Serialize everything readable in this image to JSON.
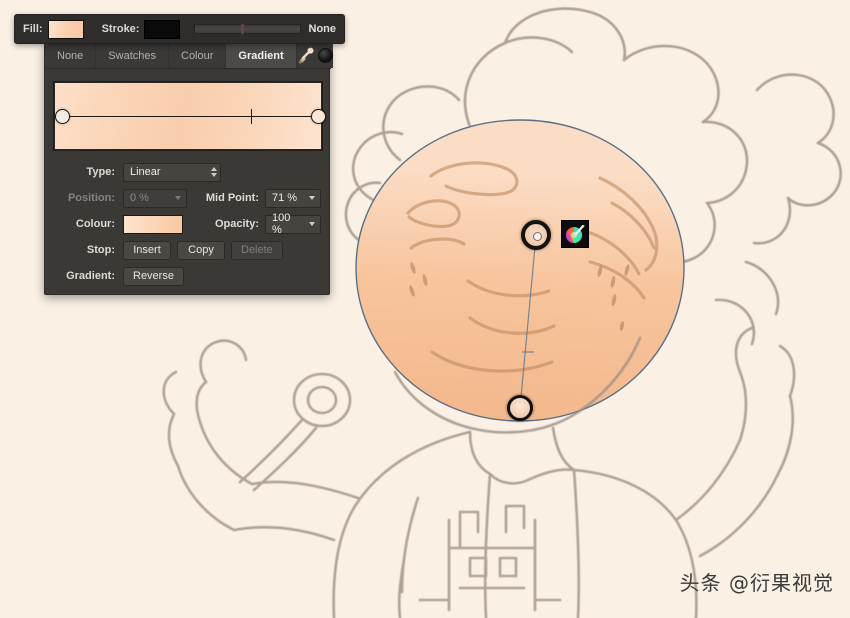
{
  "app": {
    "background_color": "#faf0e4"
  },
  "fill_stroke_bar": {
    "fill_label": "Fill:",
    "stroke_label": "Stroke:",
    "none_label": "None",
    "fill_color": "#fbcfae",
    "stroke_color": "#0b0a0a"
  },
  "panel": {
    "tabs": [
      {
        "label": "None",
        "active": false
      },
      {
        "label": "Swatches",
        "active": false
      },
      {
        "label": "Colour",
        "active": false
      },
      {
        "label": "Gradient",
        "active": true
      }
    ],
    "tools": {
      "pipette": "eyedropper-icon",
      "swatch": "dark-circle-swatch"
    },
    "gradient_preview": {
      "start_color": "#fcdfc8",
      "mid_color": "#f9cdac",
      "end_color": "#fde3cf",
      "midpoint_position": "71 %"
    },
    "fields": {
      "type_label": "Type:",
      "type_value": "Linear",
      "position_label": "Position:",
      "position_value": "0 %",
      "midpoint_label": "Mid Point:",
      "midpoint_value": "71 %",
      "colour_label": "Colour:",
      "colour_value": "#fbcfae",
      "opacity_label": "Opacity:",
      "opacity_value": "100 %",
      "stop_label": "Stop:",
      "stop_insert": "Insert",
      "stop_copy": "Copy",
      "stop_delete": "Delete",
      "gradient_label": "Gradient:",
      "gradient_reverse": "Reverse"
    }
  },
  "canvas": {
    "gradient_widget": {
      "start_handle": "gradient-start-stop",
      "end_handle": "gradient-end-stop",
      "color_wheel_button": "colour-wheel-icon"
    }
  },
  "watermark": {
    "text": "头条 @衍果视觉"
  }
}
